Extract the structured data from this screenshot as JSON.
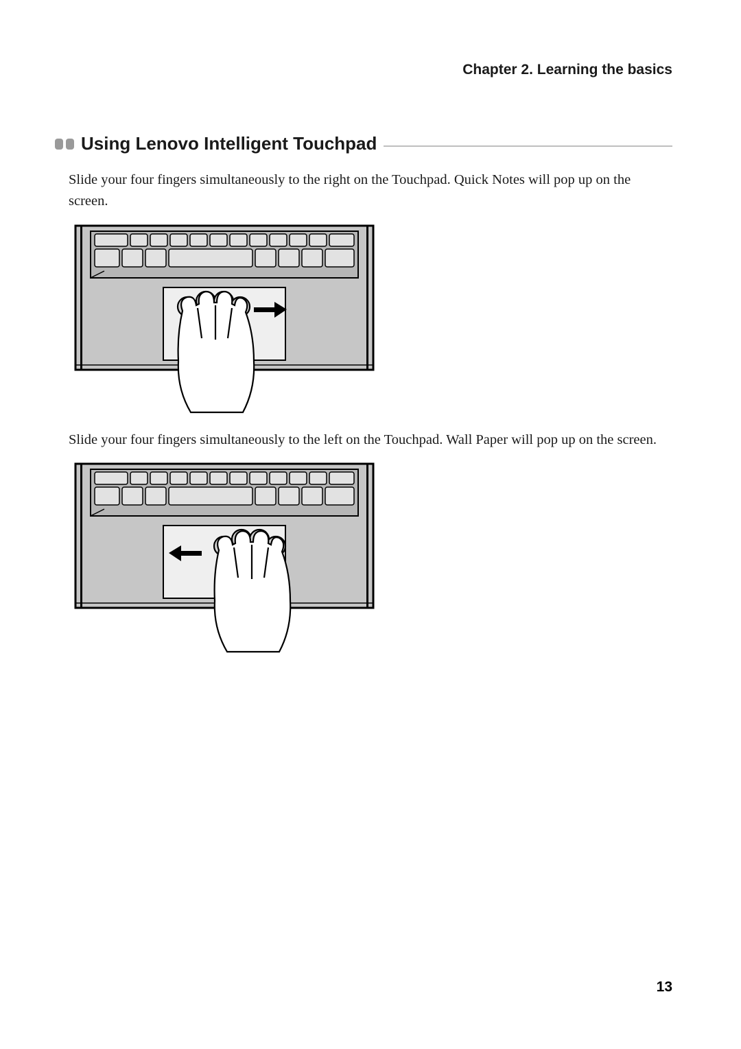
{
  "header": {
    "chapter": "Chapter 2. Learning the basics"
  },
  "section": {
    "title": "Using Lenovo Intelligent Touchpad"
  },
  "paragraphs": {
    "p1": "Slide your four fingers simultaneously to the right on the Touchpad. Quick Notes will pop up on the screen.",
    "p2": "Slide your four fingers simultaneously to the left on the Touchpad. Wall Paper will pop up on the screen."
  },
  "pageNumber": "13",
  "illustrations": {
    "img1_alt": "laptop-touchpad-swipe-right",
    "img2_alt": "laptop-touchpad-swipe-left"
  }
}
